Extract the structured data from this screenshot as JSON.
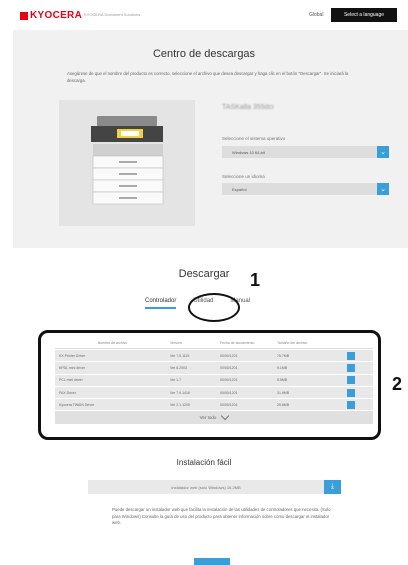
{
  "header": {
    "logo_text": "KYOCERA",
    "logo_subtitle": "KYOCERA Document Solutions",
    "link": "Global",
    "language_button": "Select a language"
  },
  "download_center": {
    "title": "Centro de descargas",
    "description": "Asegúrese de que el nombre del producto es correcto, seleccione el archivo que desea descargar y haga clic en el botón \"Descargar\". Se iniciará la descarga.",
    "product_name": "TASKalfa 355dci",
    "os_label": "Seleccione el sistema operativo",
    "os_value": "Windows 10 64-bit",
    "lang_label": "Seleccione un idioma",
    "lang_value": "Español"
  },
  "downloads": {
    "title": "Descargar",
    "tabs": [
      "Controlador",
      "Utilidad",
      "Manual"
    ],
    "active_tab": "Controlador",
    "columns": [
      "Nombre de archivo",
      "Versión",
      "Fecha de lanzamiento",
      "Tamaño del archivo"
    ],
    "rows": [
      {
        "name": "KX Printer Driver",
        "version": "Ver 7.5.1115",
        "date": "00/00/1201",
        "size": "75.7MB"
      },
      {
        "name": "KPDL mini driver",
        "version": "Ver 8.2003",
        "date": "00/00/1201",
        "size": "9.1MB"
      },
      {
        "name": "PCL mini driver",
        "version": "Ver 1.7",
        "date": "00/00/1201",
        "size": "8.5MB"
      },
      {
        "name": "FAX Driver",
        "version": "Ver 7.9.1416",
        "date": "00/00/1201",
        "size": "31.9MB"
      },
      {
        "name": "Kyocera TWAIN Driver",
        "version": "Ver 2.1.1200",
        "date": "00/00/1201",
        "size": "25.6MB"
      }
    ],
    "view_all": "Ver todo"
  },
  "annotations": {
    "one": "1",
    "two": "2"
  },
  "easy_install": {
    "title": "Instalación fácil",
    "bar_text": "Instalador web (solo Windows)  16.2MB",
    "description": "Puede descargar un instalador web que facilita la instalación de las utilidades de controladores que necesita. (Solo para Windows) Consulte la guía de uso del producto para obtener información sobre cómo descargar el instalador web."
  },
  "colors": {
    "accent": "#3a9ed9",
    "brand": "#e60012"
  }
}
